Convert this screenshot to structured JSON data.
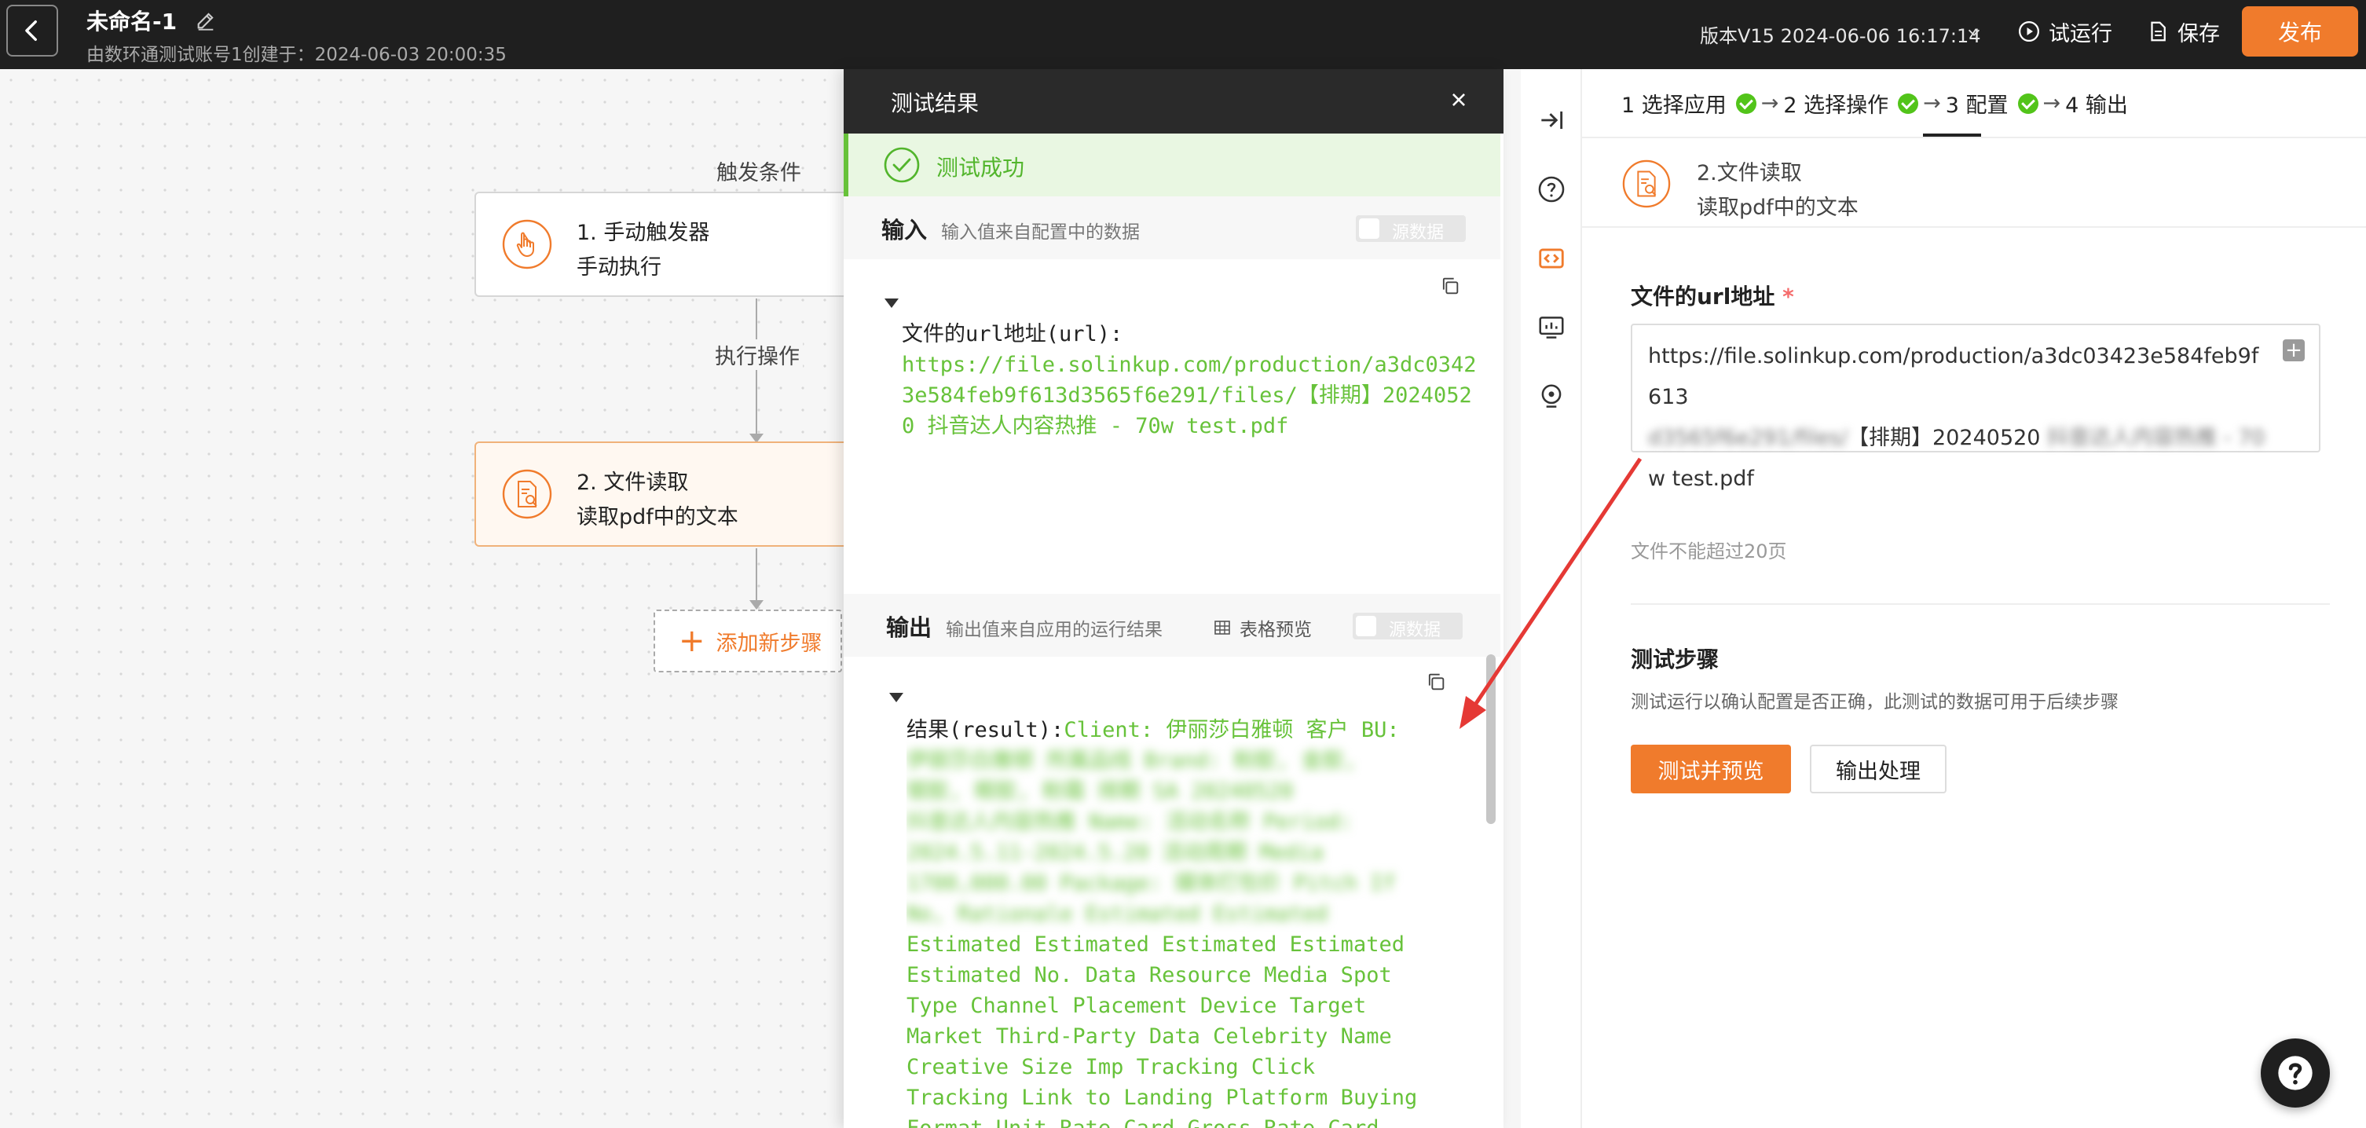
{
  "topbar": {
    "title": "未命名-1",
    "subtitle": "由数环通测试账号1创建于：2024-06-03 20:00:35",
    "version": "版本V15 2024-06-06 16:17:14",
    "trial_run": "试运行",
    "save": "保存",
    "publish": "发布"
  },
  "canvas": {
    "trigger_label": "触发条件",
    "action_label": "执行操作",
    "nodes": [
      {
        "title": "1. 手动触发器",
        "subtitle": "手动执行"
      },
      {
        "title": "2. 文件读取",
        "subtitle": "读取pdf中的文本"
      }
    ],
    "add_step": "添加新步骤"
  },
  "test_result": {
    "title": "测试结果",
    "status": "测试成功",
    "input": {
      "title": "输入",
      "desc": "输入值来自配置中的数据",
      "raw_toggle": "源数据",
      "key": "文件的url地址(url):",
      "value": "https://file.solinkup.com/production/a3dc03423e584feb9f613d3565f6e291/files/【排期】20240520 抖音达人内容热推 - 70w test.pdf"
    },
    "output": {
      "title": "输出",
      "desc": "输出值来自应用的运行结果",
      "table_preview": "表格预览",
      "raw_toggle": "源数据",
      "key": "结果(result):",
      "value_visible_start": "Client: 伊丽莎白雅顿 客户 BU:",
      "value_lines_blurred": [
        "伊丽莎白雅顿 所属品线 Brand: 粉胶, 金胶,",
        "银胶, 眼胶, 粉霜 排期 SA 20240520",
        "抖音达人内容热推 Name: 活动名称 Period:",
        "2024.5.11-2024.5.20 活动周期 Media",
        "1700,000.00 Package: 媒体打包价 Pitch If",
        "No, Rationale Estimated Estimated"
      ],
      "value_lines_clear": [
        "Estimated Estimated Estimated Estimated",
        "Estimated No. Data Resource Media Spot",
        "Type Channel Placement Device Target",
        "Market Third-Party Data Celebrity Name",
        "Creative Size Imp Tracking Click",
        "Tracking Link to Landing Platform Buying",
        "Format Unit Rate Card Gross Rate Card"
      ]
    }
  },
  "config": {
    "steps": [
      {
        "label": "1 选择应用"
      },
      {
        "label": "2 选择操作"
      },
      {
        "label": "3 配置"
      },
      {
        "label": "4 输出"
      }
    ],
    "app_name": "2.文件读取",
    "app_action": "读取pdf中的文本",
    "url_field_label": "文件的url地址",
    "url_field_required": "*",
    "url_value_line1": "https://file.solinkup.com/production/a3dc03423e584feb9f613",
    "url_value_line2_blurred": "d3565f6e291/files/",
    "url_value_line2_clear": "【排期】20240520",
    "url_value_line2_blurred_tail": "抖音达人内容热推 - 70",
    "url_value_line3": "w test.pdf",
    "url_hint": "文件不能超过20页",
    "test_title": "测试步骤",
    "test_desc": "测试运行以确认配置是否正确，此测试的数据可用于后续步骤",
    "test_preview_btn": "测试并预览",
    "output_process_btn": "输出处理"
  },
  "colors": {
    "accent": "#f07b2c",
    "success": "#67c23a",
    "topbar_bg": "#1f1f1f"
  }
}
